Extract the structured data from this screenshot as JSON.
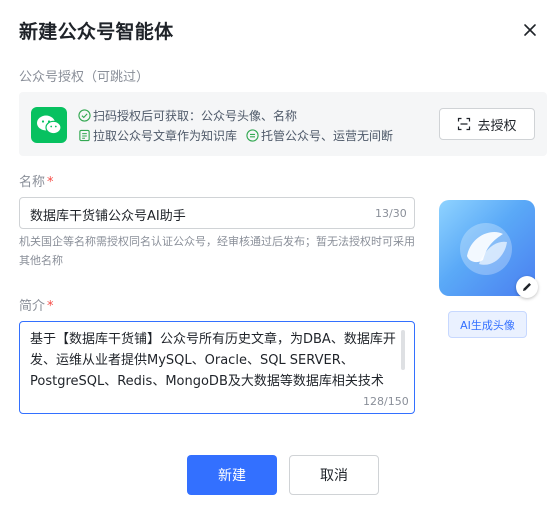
{
  "dialog": {
    "title": "新建公众号智能体",
    "close_icon": "close-icon"
  },
  "auth": {
    "section_label": "公众号授权（可跳过）",
    "logo_icon": "wechat-icon",
    "features": [
      {
        "icon": "check-circle-icon",
        "text": "扫码授权后可获取：公众号头像、名称"
      },
      {
        "icon": "document-icon",
        "text": "拉取公众号文章作为知识库"
      },
      {
        "icon": "equal-circle-icon",
        "text": "托管公众号、运营无间断"
      }
    ],
    "button_icon": "scan-icon",
    "button_label": "去授权"
  },
  "name_field": {
    "label": "名称",
    "required_mark": "*",
    "value": "数据库干货铺公众号AI助手",
    "count": "13/30",
    "hint": "机关国企等名称需授权同名认证公众号，经审核通过后发布；暂无法授权时可采用其他名称"
  },
  "intro_field": {
    "label": "简介",
    "required_mark": "*",
    "value": "基于【数据库干货铺】公众号所有历史文章，为DBA、数据库开发、运维从业者提供MySQL、Oracle、SQL SERVER、PostgreSQL、Redis、MongoDB及大数据等数据库相关技术",
    "count": "128/150"
  },
  "avatar": {
    "edit_icon": "pencil-icon",
    "ai_button_label": "AI生成头像"
  },
  "footer": {
    "create_label": "新建",
    "cancel_label": "取消"
  },
  "colors": {
    "primary": "#3370ff",
    "required": "#f54a45",
    "wechat": "#07c160",
    "feature_icon": "#33a852"
  }
}
